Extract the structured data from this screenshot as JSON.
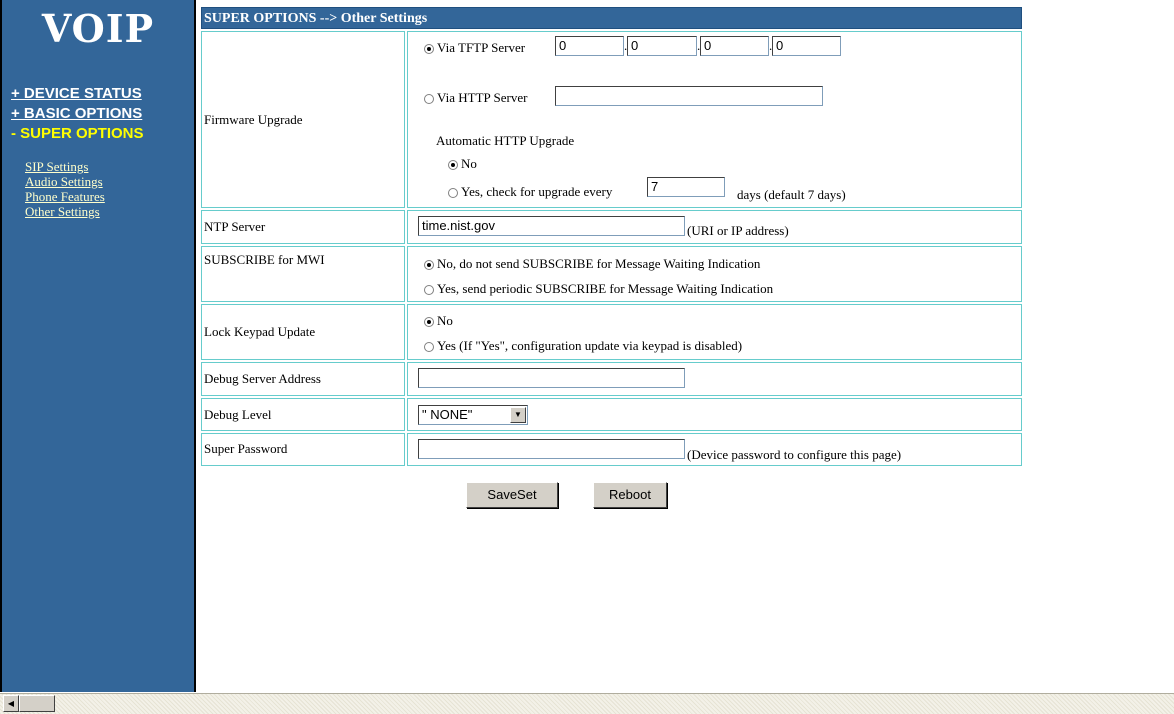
{
  "sidebar": {
    "logo": "VOIP",
    "nav": [
      {
        "label": "+ DEVICE STATUS"
      },
      {
        "label": "+ BASIC OPTIONS"
      },
      {
        "label": "- SUPER OPTIONS"
      }
    ],
    "sub_items": [
      {
        "label": "SIP Settings"
      },
      {
        "label": "Audio Settings"
      },
      {
        "label": "Phone Features"
      },
      {
        "label": "Other Settings"
      }
    ]
  },
  "header": {
    "title": "SUPER OPTIONS --> Other Settings"
  },
  "firmware": {
    "label": "Firmware Upgrade",
    "tftp_label": "Via TFTP Server",
    "tftp_ip": [
      "0",
      "0",
      "0",
      "0"
    ],
    "dot": ".",
    "http_label": "Via HTTP Server",
    "http_value": "",
    "auto_title": "Automatic HTTP Upgrade",
    "no_label": "No",
    "yes_label": "Yes, check for upgrade every",
    "days_value": "7",
    "days_suffix": "days (default 7 days)"
  },
  "ntp": {
    "label": "NTP Server",
    "value": "time.nist.gov",
    "hint": "(URI or IP address)"
  },
  "mwi": {
    "label": "SUBSCRIBE for MWI",
    "opt_no": "No, do not send SUBSCRIBE for Message Waiting Indication",
    "opt_yes": "Yes, send periodic SUBSCRIBE for Message Waiting Indication"
  },
  "lock": {
    "label": "Lock Keypad Update",
    "opt_no": "No",
    "opt_yes": "Yes  (If \"Yes\", configuration update via keypad is disabled)"
  },
  "debug_server": {
    "label": "Debug Server Address",
    "value": ""
  },
  "debug_level": {
    "label": "Debug Level",
    "selected": "\" NONE\""
  },
  "super_password": {
    "label": "Super Password",
    "value": "",
    "hint": "(Device password to configure this page)"
  },
  "buttons": {
    "saveset": "SaveSet",
    "reboot": "Reboot"
  }
}
